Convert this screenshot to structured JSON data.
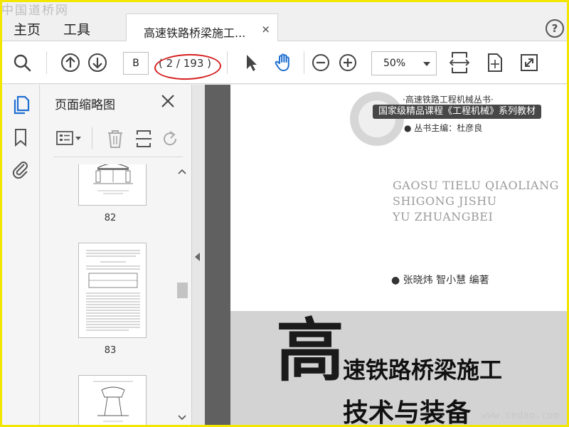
{
  "watermark": {
    "top": "中国道桥网",
    "bottom": "www.cndao.com"
  },
  "menu": {
    "home": "主页",
    "tools": "工具"
  },
  "tab": {
    "title": "高速铁路桥梁施工...",
    "close": "×"
  },
  "help": "?",
  "toolbar": {
    "page_input": "B",
    "page_count": "( 2 / 193 )",
    "zoom": "50%"
  },
  "thumbnails": {
    "title": "页面缩略图",
    "pages": [
      {
        "label": "82"
      },
      {
        "label": "83"
      },
      {
        "label": ""
      }
    ]
  },
  "document": {
    "series": "·高速铁路工程机械丛书·",
    "badge": "国家级精品课程《工程机械》系列教材",
    "editor": "● 丛书主编：杜彦良",
    "pinyin": [
      "GAOSU TIELU QIAOLIANG",
      "SHIGONG JISHU",
      "YU ZHUANGBEI"
    ],
    "authors": "● 张晓炜  智小慧   编著",
    "title_big": "高",
    "title_line1": "速铁路桥梁施工",
    "title_line2": "技术与装备"
  },
  "colors": {
    "accent_blue": "#1f6fd1",
    "annotation_red": "#d62020",
    "frame_yellow": "#f2e600"
  }
}
